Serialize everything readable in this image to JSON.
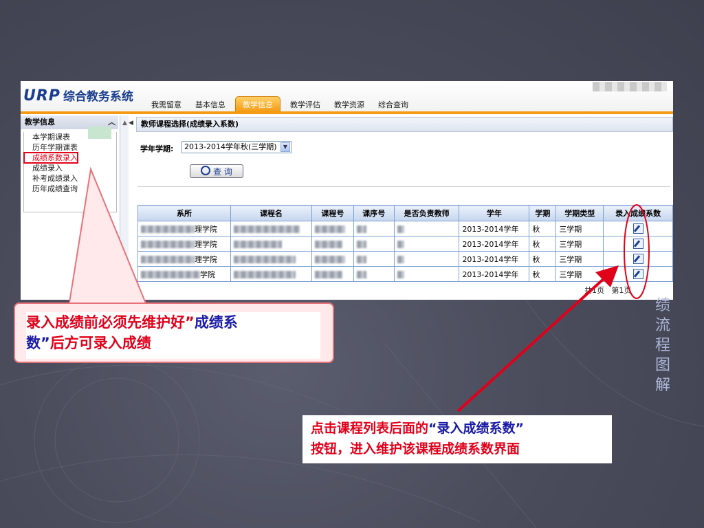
{
  "app": {
    "logo_brand": "URP",
    "logo_name": "综合教务系统"
  },
  "nav_tabs": [
    "我需留意",
    "基本信息",
    "教学信息",
    "教学评估",
    "教学资源",
    "综合查询"
  ],
  "active_tab_index": 2,
  "sidebar": {
    "title": "教学信息",
    "collapse_icon": "chevron-up-icon",
    "items": [
      "本学期课表",
      "历年学期课表",
      "成绩系数录入",
      "成绩录入",
      "补考成绩录入",
      "历年成绩查询"
    ],
    "highlighted_index": 2
  },
  "main": {
    "title": "教师课程选择(成绩录入系数)",
    "term_label": "学年学期:",
    "term_value": "2013-2014学年秋(三学期)",
    "query_button": "查 询",
    "table": {
      "headers": [
        "系所",
        "课程名",
        "课程号",
        "课序号",
        "是否负责教师",
        "学年",
        "学期",
        "学期类型",
        "录入成绩系数"
      ],
      "rows": [
        {
          "dept_suffix": "理学院",
          "year": "2013-2014学年",
          "term": "秋",
          "term_type": "三学期"
        },
        {
          "dept_suffix": "理学院",
          "year": "2013-2014学年",
          "term": "秋",
          "term_type": "三学期"
        },
        {
          "dept_suffix": "理学院",
          "year": "2013-2014学年",
          "term": "秋",
          "term_type": "三学期"
        },
        {
          "dept_suffix": "学院",
          "year": "2013-2014学年",
          "term": "秋",
          "term_type": "三学期"
        }
      ]
    },
    "pager": {
      "total": "共1页",
      "current": "第1页"
    }
  },
  "callouts": {
    "left_line1_red": "录入成绩前必须先维护好”",
    "left_line1_blue": "成绩系",
    "left_line2_blue": "数”",
    "left_line2_red": "后方可录入成绩",
    "right_line1_red": "点击课程列表后面的",
    "right_line1_blue": "“录入成绩系数”",
    "right_line2_red": "按钮，进入维护该课程成绩系数界面"
  },
  "side_vertical_text": [
    "绩",
    "流",
    "程",
    "图",
    "解"
  ],
  "colors": {
    "accent_orange": "#f39a12",
    "callout_red": "#e0001a",
    "callout_blue": "#1a1aa8",
    "logo_blue": "#1a3d8f"
  }
}
